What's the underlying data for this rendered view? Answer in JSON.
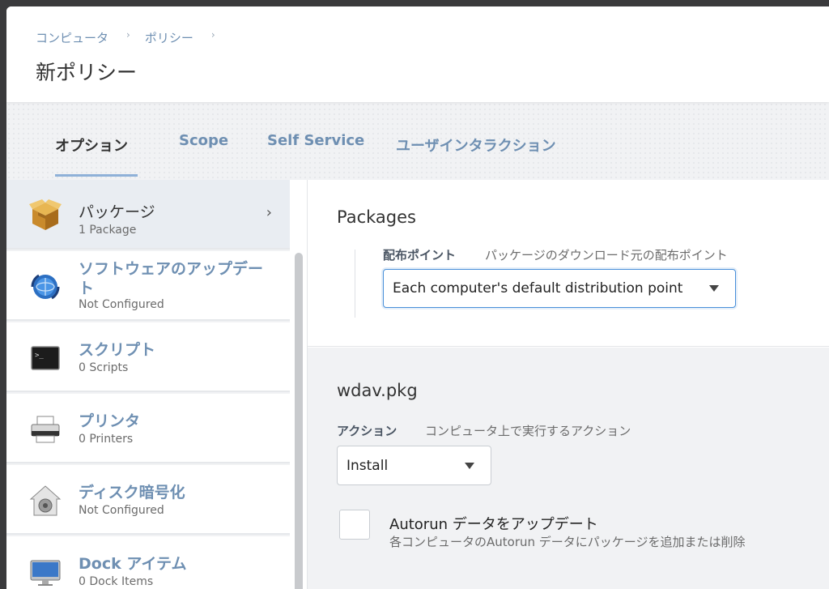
{
  "breadcrumb": {
    "items": [
      "コンピュータ",
      "ポリシー"
    ],
    "separator": "›"
  },
  "page_title": "新ポリシー",
  "tabs": [
    {
      "label": "オプション",
      "active": true
    },
    {
      "label": "Scope",
      "active": false
    },
    {
      "label": "Self Service",
      "active": false
    },
    {
      "label": "ユーザインタラクション",
      "active": false
    }
  ],
  "sidebar": {
    "items": [
      {
        "label": "パッケージ",
        "sub": "1 Package",
        "icon": "package-icon",
        "active": true
      },
      {
        "label": "ソフトウェアのアップデート",
        "sub": "Not Configured",
        "icon": "software-update-icon"
      },
      {
        "label": "スクリプト",
        "sub": "0 Scripts",
        "icon": "terminal-icon"
      },
      {
        "label": "プリンタ",
        "sub": "0 Printers",
        "icon": "printer-icon"
      },
      {
        "label": "ディスク暗号化",
        "sub": "Not Configured",
        "icon": "disk-encryption-icon"
      },
      {
        "label": "Dock アイテム",
        "sub": "0 Dock Items",
        "icon": "monitor-icon"
      }
    ],
    "chevron": "›"
  },
  "packages": {
    "title": "Packages",
    "distribution_label": "配布ポイント",
    "distribution_desc": "パッケージのダウンロード元の配布ポイント",
    "distribution_value": "Each computer's default distribution point"
  },
  "package_item": {
    "name": "wdav.pkg",
    "action_label": "アクション",
    "action_desc": "コンピュータ上で実行するアクション",
    "action_value": "Install",
    "autorun_label": "Autorun データをアップデート",
    "autorun_desc": "各コンピュータのAutorun データにパッケージを追加または削除",
    "autorun_checked": false
  },
  "colors": {
    "accent": "#6e8fb2",
    "tab_underline": "#8fb1d8",
    "focus": "#4a90d9"
  }
}
